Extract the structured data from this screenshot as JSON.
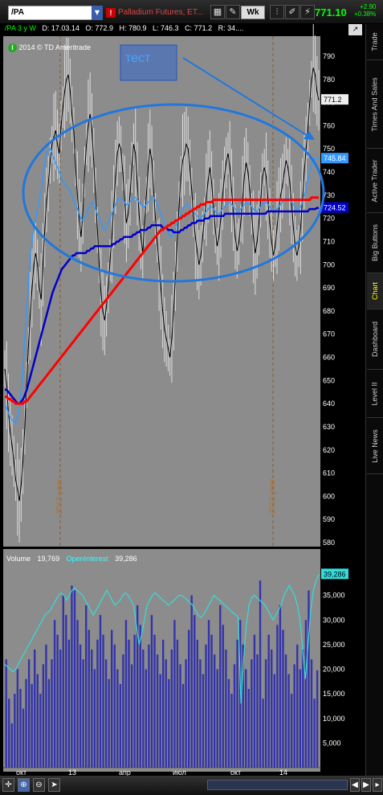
{
  "toolbar": {
    "symbol": "/PA",
    "description": "Palladium Futures, ET...",
    "alert_badge": "!",
    "period_button": "Wk",
    "last_price": "771.10",
    "change": "+2.90",
    "change_pct": "+0.38%"
  },
  "infobar": {
    "study": "/PA 3 y W",
    "date": "D: 17.03.14",
    "open": "O: 772.9",
    "high": "H: 780.9",
    "low": "L: 746.3",
    "close": "C: 771.2",
    "range": "R: 34...."
  },
  "watermark": "2014 © TD Ameritrade",
  "annotation": "тест",
  "right_tabs": [
    "Trade",
    "Times And Sales",
    "Active Trader",
    "Big Buttons",
    "Chart",
    "Dashboard",
    "Level II",
    "Live News"
  ],
  "active_tab": "Chart",
  "volume_header": {
    "volume_label": "Volume",
    "volume_value": "19,769",
    "oi_label": "OpenInterest",
    "oi_value": "39,286"
  },
  "colors": {
    "price_line": "#000000",
    "ma_fast": "#3399ff",
    "ma_mid": "#0000cc",
    "ma_slow": "#ff0000",
    "panel_bg": "#8c8c8c",
    "volume_bar": "#3333aa",
    "oi_line": "#33dddd",
    "accent": "#00ff00"
  },
  "chart_data": [
    {
      "type": "line",
      "ylim": [
        580,
        790
      ],
      "price_ticks": [
        790,
        780,
        770,
        760,
        750,
        740,
        730,
        720,
        710,
        700,
        690,
        680,
        670,
        660,
        650,
        640,
        630,
        620,
        610,
        600,
        590,
        580
      ],
      "year_markers": [
        "2012 year",
        "2013 year"
      ],
      "price_labels": {
        "last": "771.2",
        "ma_fast": "745.84",
        "ma_mid": "724.52"
      },
      "series": [
        {
          "values": [
            655,
            648,
            636,
            628,
            622,
            615,
            607,
            603,
            598,
            605,
            615,
            630,
            648,
            665,
            678,
            690,
            700,
            705,
            700,
            690,
            685,
            700,
            715,
            728,
            735,
            745,
            752,
            755,
            758,
            752,
            748,
            760,
            768,
            775,
            780,
            782,
            775,
            765,
            758,
            742,
            730,
            720,
            712,
            722,
            740,
            752,
            760,
            765,
            758,
            745,
            730,
            715,
            700,
            688,
            680,
            676,
            682,
            690,
            702,
            712,
            725,
            738,
            748,
            752,
            750,
            740,
            728,
            718,
            722,
            730,
            742,
            752,
            748,
            735,
            722,
            712,
            705,
            718,
            730,
            742,
            750,
            745,
            732,
            720,
            710,
            700,
            690,
            680,
            672,
            668,
            664,
            660,
            668,
            680,
            695,
            710,
            725,
            738,
            745,
            748,
            752,
            750,
            742,
            732,
            720,
            712,
            706,
            700,
            704,
            712,
            720,
            728,
            736,
            742,
            735,
            725,
            715,
            708,
            712,
            720,
            730,
            738,
            744,
            748,
            742,
            732,
            722,
            712,
            706,
            710,
            718,
            728,
            738,
            744,
            740,
            732,
            722,
            712,
            705,
            710,
            718,
            728,
            738,
            742,
            738,
            728,
            718,
            710,
            704,
            708,
            716,
            724,
            730,
            734,
            740,
            745,
            742,
            736,
            726,
            716,
            708,
            704,
            708,
            716,
            728,
            740,
            750,
            758,
            770,
            780,
            785,
            782,
            775,
            771
          ]
        },
        {
          "values": [
            640,
            638,
            636,
            634,
            633,
            632,
            632,
            634,
            638,
            645,
            655,
            668,
            680,
            692,
            702,
            710,
            716,
            720,
            724,
            728,
            732,
            738,
            744,
            748,
            750,
            750,
            748,
            746,
            744,
            742,
            740,
            738,
            736,
            735,
            734,
            733,
            732,
            730,
            728,
            726,
            724,
            722,
            720,
            719,
            720,
            722,
            724,
            726,
            727,
            726,
            724,
            722,
            720,
            718,
            716,
            715,
            716,
            718,
            720,
            722,
            724,
            726,
            728,
            729,
            729,
            728,
            727,
            726,
            726,
            727,
            728,
            729,
            729,
            728,
            727,
            726,
            725,
            725,
            726,
            727,
            728,
            729,
            729,
            728,
            726,
            724,
            722,
            720,
            718,
            716,
            714,
            712,
            712,
            713,
            715,
            718,
            720,
            722,
            724,
            725,
            726,
            726,
            725,
            724,
            723,
            722,
            721,
            720,
            720,
            721,
            722,
            723,
            724,
            725,
            725,
            724,
            723,
            722,
            722,
            723,
            724,
            725,
            726,
            727,
            727,
            726,
            725,
            724,
            723,
            723,
            724,
            725,
            726,
            727,
            727,
            726,
            725,
            724,
            723,
            723,
            724,
            725,
            726,
            727,
            727,
            726,
            725,
            724,
            723,
            723,
            724,
            725,
            726,
            727,
            728,
            729,
            729,
            728,
            727,
            726,
            725,
            724,
            724,
            725,
            727,
            730,
            733,
            736,
            740,
            743,
            745,
            746,
            746,
            745.84
          ]
        },
        {
          "values": [
            646,
            646,
            645,
            644,
            643,
            642,
            641,
            640,
            640,
            641,
            642,
            644,
            646,
            649,
            652,
            655,
            658,
            661,
            664,
            667,
            670,
            673,
            676,
            679,
            682,
            685,
            688,
            690,
            692,
            694,
            696,
            698,
            699,
            700,
            701,
            702,
            703,
            704,
            704,
            705,
            705,
            705,
            705,
            705,
            705,
            706,
            706,
            707,
            707,
            708,
            708,
            708,
            708,
            708,
            708,
            708,
            708,
            708,
            708,
            709,
            709,
            710,
            710,
            711,
            711,
            712,
            712,
            712,
            712,
            712,
            713,
            713,
            714,
            714,
            715,
            715,
            715,
            715,
            716,
            716,
            717,
            717,
            717,
            717,
            717,
            717,
            716,
            716,
            716,
            715,
            715,
            715,
            714,
            714,
            714,
            714,
            715,
            715,
            716,
            716,
            717,
            717,
            718,
            718,
            718,
            719,
            719,
            719,
            719,
            720,
            720,
            720,
            721,
            721,
            721,
            721,
            721,
            721,
            721,
            721,
            722,
            722,
            722,
            722,
            722,
            722,
            722,
            722,
            722,
            722,
            722,
            722,
            722,
            722,
            722,
            722,
            722,
            722,
            722,
            722,
            722,
            722,
            722,
            723,
            723,
            723,
            723,
            723,
            723,
            723,
            723,
            723,
            723,
            723,
            723,
            723,
            723,
            723,
            723,
            723,
            723,
            723,
            723,
            723,
            723,
            723,
            724,
            724,
            724,
            724,
            724.5,
            724.52
          ]
        },
        {
          "values": [
            643,
            643,
            642,
            642,
            641,
            641,
            640,
            640,
            640,
            640,
            640,
            641,
            641,
            642,
            643,
            644,
            645,
            646,
            647,
            648,
            649,
            650,
            651,
            652,
            653,
            654,
            655,
            656,
            657,
            658,
            659,
            660,
            661,
            662,
            663,
            664,
            665,
            666,
            667,
            668,
            669,
            670,
            671,
            672,
            673,
            674,
            675,
            676,
            677,
            678,
            679,
            680,
            681,
            682,
            683,
            684,
            685,
            686,
            687,
            688,
            689,
            690,
            691,
            692,
            693,
            694,
            695,
            696,
            697,
            698,
            699,
            700,
            701,
            702,
            703,
            704,
            705,
            706,
            707,
            708,
            709,
            710,
            711,
            712,
            713,
            714,
            715,
            715,
            716,
            716,
            717,
            717,
            718,
            718,
            719,
            719,
            720,
            720,
            721,
            721,
            722,
            722,
            723,
            723,
            724,
            724,
            725,
            725,
            726,
            726,
            726,
            727,
            727,
            727,
            727,
            728,
            728,
            728,
            728,
            728,
            728,
            728,
            728,
            728,
            728,
            728,
            728,
            728,
            728,
            728,
            728,
            728,
            728,
            728,
            728,
            728,
            728,
            728,
            728,
            728,
            728,
            728,
            728,
            728,
            728,
            728,
            728,
            728,
            728,
            728,
            728,
            728,
            728,
            728,
            728,
            728,
            728,
            728,
            728,
            728,
            728,
            728,
            728,
            728,
            728,
            728,
            728,
            728,
            728,
            729,
            729,
            729,
            729,
            729
          ]
        }
      ]
    },
    {
      "type": "bar",
      "x_ticks": [
        "окт",
        "13",
        "апр",
        "июл",
        "окт",
        "14"
      ],
      "volume_ticks": [
        35000,
        30000,
        25000,
        20000,
        15000,
        10000,
        5000
      ],
      "volume_tick_labels": [
        "35,000",
        "30,000",
        "25,000",
        "20,000",
        "15,000",
        "10,000",
        "5,000"
      ],
      "ylim": [
        0,
        40000
      ],
      "series": [
        {
          "name": "Volume",
          "values": [
            22000,
            14000,
            9000,
            15000,
            20000,
            16000,
            12000,
            18000,
            22000,
            17000,
            24000,
            19000,
            15000,
            21000,
            25000,
            18000,
            22000,
            30000,
            27000,
            24000,
            35000,
            31000,
            26000,
            37000,
            36000,
            30000,
            25000,
            22000,
            33000,
            28000,
            24000,
            20000,
            26000,
            31000,
            27000,
            22000,
            18000,
            28000,
            25000,
            20000,
            17000,
            23000,
            30000,
            26000,
            21000,
            27000,
            33000,
            29000,
            24000,
            20000,
            25000,
            31000,
            27000,
            23000,
            19000,
            26000,
            22000,
            18000,
            24000,
            30000,
            26000,
            21000,
            17000,
            22000,
            28000,
            35000,
            31000,
            26000,
            22000,
            19000,
            25000,
            30000,
            27000,
            23000,
            20000,
            33000,
            29000,
            24000,
            18000,
            15000,
            21000,
            26000,
            30000,
            25000,
            20000,
            16000,
            22000,
            27000,
            23000,
            38000,
            14000,
            22000,
            27000,
            24000,
            19000,
            29000,
            33000,
            28000,
            23000,
            19000,
            15000,
            21000,
            25000,
            20000,
            24000,
            30000,
            36000,
            22000,
            14000,
            19769
          ]
        },
        {
          "name": "OpenInterest",
          "values": [
            21000,
            20500,
            20000,
            19500,
            20000,
            21000,
            22000,
            23000,
            24000,
            25000,
            26000,
            27000,
            28000,
            29000,
            30000,
            31000,
            31500,
            32000,
            33000,
            34000,
            35000,
            35500,
            35000,
            34000,
            35000,
            36000,
            36500,
            36000,
            35500,
            35000,
            34000,
            33000,
            32000,
            31000,
            32000,
            33000,
            34000,
            35000,
            36000,
            35000,
            34000,
            33000,
            33500,
            34000,
            35000,
            35500,
            35000,
            34000,
            33000,
            29000,
            25000,
            27000,
            30000,
            33000,
            34000,
            35000,
            35500,
            35000,
            34500,
            34000,
            33500,
            33000,
            33500,
            34000,
            34500,
            35000,
            35000,
            34500,
            34000,
            33500,
            33000,
            32000,
            31000,
            30500,
            31000,
            32000,
            33000,
            34000,
            35000,
            34500,
            34000,
            33500,
            33000,
            32500,
            32000,
            31500,
            31000,
            30500,
            13000,
            22000,
            29000,
            33000,
            34500,
            35000,
            34500,
            34000,
            33500,
            33000,
            32000,
            31000,
            30000,
            31000,
            32000,
            33000,
            35000,
            36000,
            37000,
            36000,
            35000,
            33000,
            30000,
            24000,
            18000,
            25000,
            32000,
            36000,
            38000,
            39286
          ]
        }
      ]
    }
  ]
}
